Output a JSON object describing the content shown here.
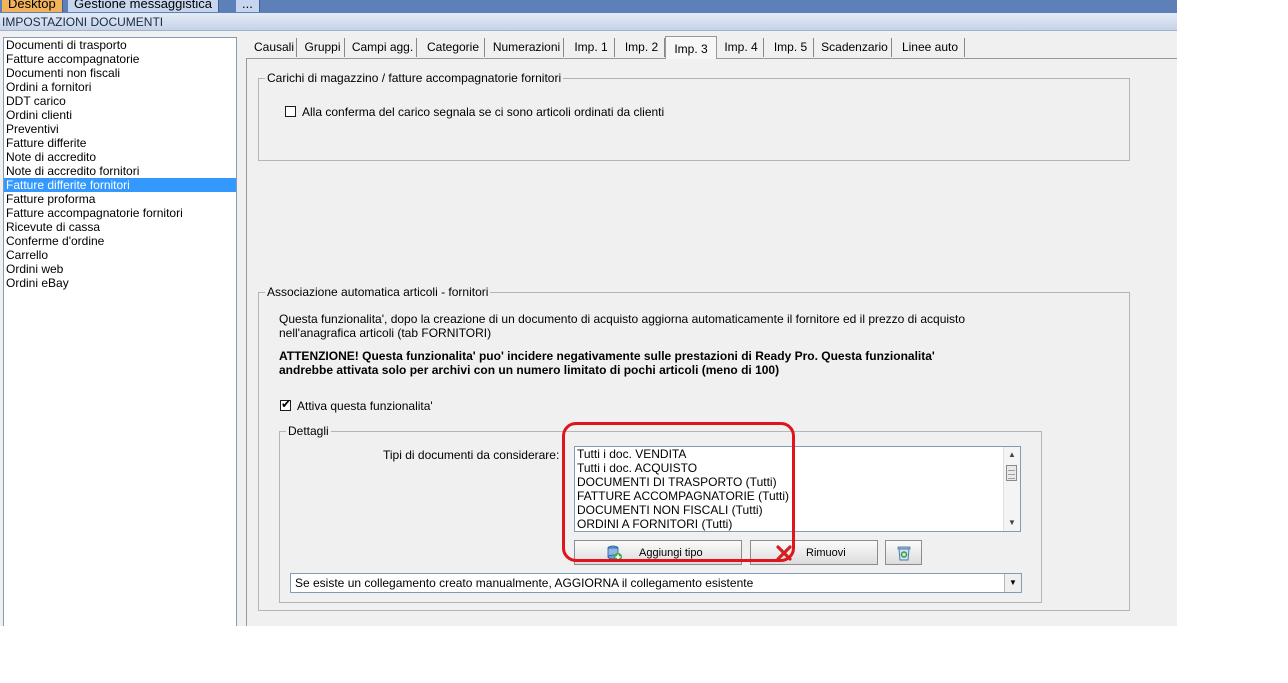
{
  "top_tabs": [
    "Desktop",
    "Gestione messaggistica",
    "..."
  ],
  "window_title": "IMPOSTAZIONI DOCUMENTI",
  "doc_types": [
    "Documenti di trasporto",
    "Fatture accompagnatorie",
    "Documenti non fiscali",
    "Ordini a fornitori",
    "DDT carico",
    "Ordini clienti",
    "Preventivi",
    "Fatture differite",
    "Note di accredito",
    "Note di accredito fornitori",
    "Fatture differite fornitori",
    "Fatture proforma",
    "Fatture accompagnatorie fornitori",
    "Ricevute di cassa",
    "Conferme d'ordine",
    "Carrello",
    "Ordini web",
    "Ordini eBay"
  ],
  "selected_doc_type": "Fatture differite fornitori",
  "tabs": [
    "Causali",
    "Gruppi",
    "Campi agg.",
    "Categorie",
    "Numerazioni",
    "Imp. 1",
    "Imp. 2",
    "Imp. 3",
    "Imp. 4",
    "Imp. 5",
    "Scadenzario",
    "Linee auto"
  ],
  "active_tab": "Imp. 3",
  "group_carichi": {
    "title": "Carichi di magazzino / fatture accompagnatorie fornitori",
    "checkbox_label": "Alla conferma del carico segnala se ci sono articoli ordinati da clienti",
    "checked": false
  },
  "group_associazione": {
    "title": "Associazione automatica articoli - fornitori",
    "desc_line1": "Questa funzionalita', dopo la creazione di un documento di acquisto aggiorna automaticamente il fornitore ed il prezzo di acquisto",
    "desc_line2": "nell'anagrafica articoli (tab FORNITORI)",
    "warn_line1": "ATTENZIONE! Questa funzionalita' puo' incidere negativamente sulle prestazioni di Ready Pro. Questa funzionalita'",
    "warn_line2": "andrebbe attivata solo per archivi con un numero limitato di pochi articoli (meno di 100)",
    "activate_label": "Attiva questa funzionalita'",
    "activate_checked": true
  },
  "dettagli": {
    "title": "Dettagli",
    "tipi_label": "Tipi di documenti da considerare:",
    "tipi_list": [
      "Tutti i doc. VENDITA",
      "Tutti i doc. ACQUISTO",
      "DOCUMENTI DI TRASPORTO (Tutti)",
      "FATTURE ACCOMPAGNATORIE (Tutti)",
      "DOCUMENTI NON FISCALI (Tutti)",
      "ORDINI A FORNITORI (Tutti)"
    ],
    "add_button": "Aggiungi tipo",
    "remove_button": "Rimuovi",
    "combo_value": "Se esiste un collegamento creato manualmente, AGGIORNA il collegamento esistente"
  },
  "colors": {
    "selection": "#3399ff",
    "highlight_annotation": "#e0141c",
    "top_active_tab": "#f2b35a"
  }
}
